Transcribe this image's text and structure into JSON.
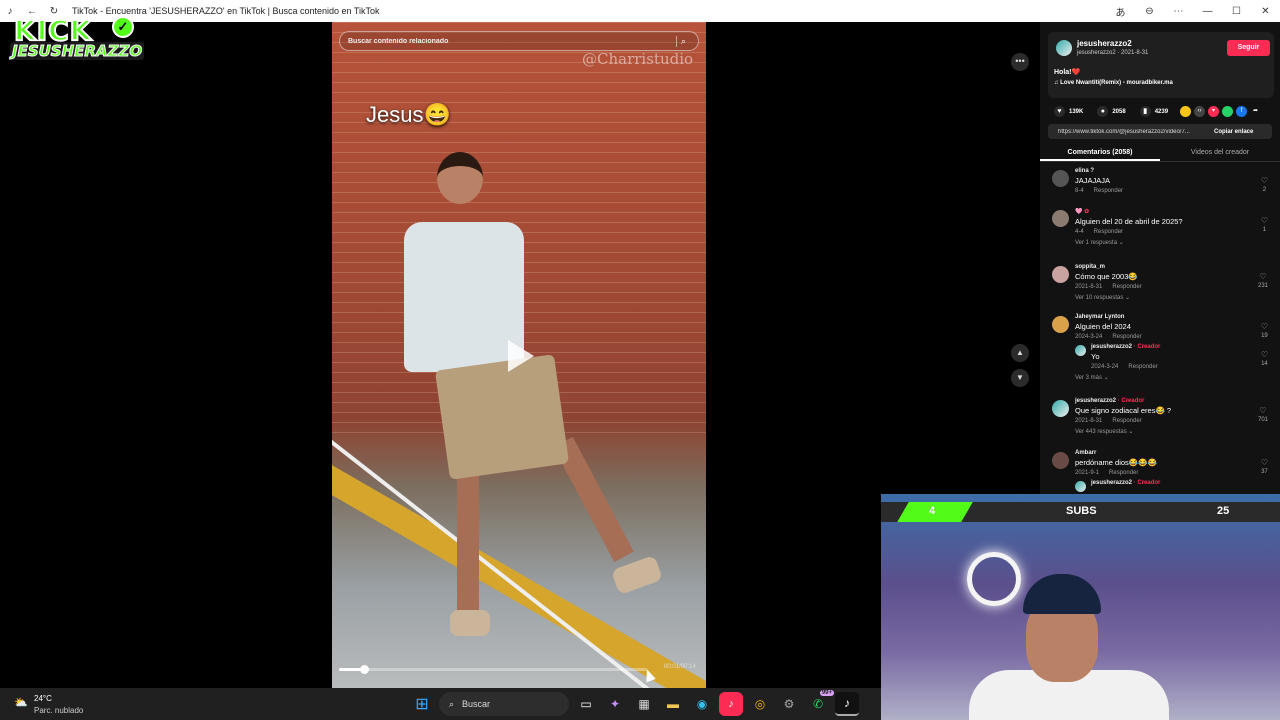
{
  "window": {
    "title": "TikTok - Encuentra 'JESUSHERAZZO' en TikTok | Busca contenido en TikTok"
  },
  "logo": {
    "line1": "KICK",
    "line2": "JESUSHERAZZO"
  },
  "search": {
    "placeholder": "Buscar contenido relacionado"
  },
  "video": {
    "watermark": "@Charristudio",
    "caption": "Jesus😄",
    "time": "00:01/00:14",
    "progress_fraction": 0.08
  },
  "creator": {
    "username": "jesusherazzo2",
    "meta": "jesusherazzo2 · 2021-8-31",
    "follow_label": "Seguir",
    "description": "Hola!❤️",
    "music": "♫ Love Nwantiti(Remix) - mouradbiker.ma"
  },
  "stats": {
    "likes": "139K",
    "comments": "2058",
    "saves": "4239"
  },
  "share_link": {
    "url": "https://www.tiktok.com/@jesusherazzo2/video/7...",
    "copy_label": "Copiar enlace"
  },
  "tabs": [
    {
      "label": "Comentarios (2058)",
      "active": true
    },
    {
      "label": "Videos del creador",
      "active": false
    }
  ],
  "reply_label": "Responder",
  "creator_label": "· Creador",
  "comments": [
    {
      "name": "elina ?",
      "text": "JAJAJAJA",
      "date": "8-4",
      "likes": "2",
      "more": ""
    },
    {
      "name": "🩷 ✿",
      "text": "Alguien del 20 de abril de 2025?",
      "date": "4-4",
      "likes": "1",
      "more": "Ver 1 respuesta ⌄"
    },
    {
      "name": "soppita_m",
      "text": "Cómo que 2003😂",
      "date": "2021-8-31",
      "likes": "231",
      "more": "Ver 10 respuestas ⌄"
    },
    {
      "name": "Jaheymar Lynton",
      "text": "Alguien del 2024",
      "date": "2024-3-24",
      "likes": "19",
      "more": "",
      "reply": {
        "name": "jesusherazzo2",
        "text": "Yo",
        "date": "2024-3-24",
        "likes": "14"
      },
      "more_after": "Ver 3 más ⌄"
    },
    {
      "name": "jesusherazzo2",
      "creator": true,
      "text": "Que signo zodiacal eres😂 ?",
      "date": "2021-8-31",
      "likes": "701",
      "more": "Ver 443 respuestas ⌄"
    },
    {
      "name": "Ambarr",
      "text": "perdóname dios😂😂😂",
      "date": "2021-9-1",
      "likes": "37",
      "more": "",
      "reply": {
        "name": "jesusherazzo2",
        "text": "",
        "date": "",
        "likes": ""
      }
    }
  ],
  "webcam": {
    "left_count": "4",
    "label": "SUBS",
    "right_count": "25"
  },
  "taskbar": {
    "temperature": "24°C",
    "condition": "Parc. nublado",
    "search_label": "Buscar",
    "badge": "99+"
  }
}
